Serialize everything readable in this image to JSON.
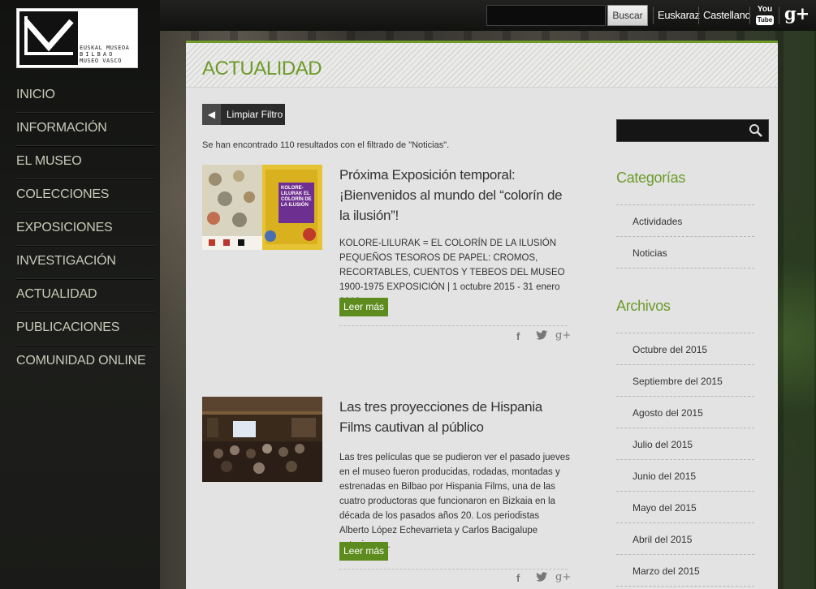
{
  "brand": {
    "logo_text_line1": "EUSKAL MUSEOA",
    "logo_text_line2": "BILBAO",
    "logo_text_line3": "MUSEO VASCO"
  },
  "topbar": {
    "search_button": "Buscar",
    "lang_eu": "Euskaraz",
    "lang_es": "Castellano",
    "youtube_label_top": "You",
    "youtube_label_bottom": "Tube",
    "gplus_label": "g+"
  },
  "nav": {
    "items": [
      {
        "label": "INICIO"
      },
      {
        "label": "INFORMACIÓN"
      },
      {
        "label": "EL MUSEO"
      },
      {
        "label": "COLECCIONES"
      },
      {
        "label": "EXPOSICIONES"
      },
      {
        "label": "INVESTIGACIÓN"
      },
      {
        "label": "ACTUALIDAD"
      },
      {
        "label": "PUBLICACIONES"
      },
      {
        "label": "COMUNIDAD ONLINE"
      }
    ]
  },
  "main": {
    "title": "ACTUALIDAD",
    "filter_button": "Limpiar Filtro",
    "results_text": "Se han encontrado 110 resultados con el filtrado de \"Noticias\".",
    "posts": [
      {
        "title": "Próxima Exposición temporal: ¡Bienvenidos al mundo del “colorín de la ilusión”!",
        "body": "KOLORE-LILURAK = EL COLORÍN DE LA ILUSIÓN PEQUEÑOS TESOROS DE PAPEL: CROMOS, RECORTABLES, CUENTOS Y TEBEOS DEL MUSEO 1900-1975 EXPOSICIÓN   |   1 octubre 2015 - 31 enero 2016",
        "thumb_caption": "KOLORE-LILURAK EL COLORÍN DE LA ILUSIÓN",
        "read_more": "Leer más"
      },
      {
        "title": "Las tres proyecciones de Hispania Films cautivan al público",
        "body": "Las tres películas  que se pudieron ver el pasado jueves en el museo fueron producidas, rodadas, montadas y estrenadas en Bilbao por Hispania Films, una de las cuatro productoras que funcionaron en Bizkaia en la década de los pasados años 20. Los periodistas Alberto López Echevarrieta y Carlos Bacigalupe estuvieron...",
        "read_more": "Leer más"
      }
    ]
  },
  "sidebar": {
    "categories_heading": "Categorías",
    "categories": [
      "Actividades",
      "Noticias"
    ],
    "archives_heading": "Archivos",
    "archives": [
      "Octubre del 2015",
      "Septiembre del 2015",
      "Agosto del 2015",
      "Julio del 2015",
      "Junio del 2015",
      "Mayo del 2015",
      "Abril del 2015",
      "Marzo del 2015"
    ]
  },
  "colors": {
    "accent_green": "#6d9a29",
    "button_green": "#5d8b1e",
    "sidebar_bg": "#1a1b18"
  },
  "icons": {
    "back": "chevron-left-icon",
    "search": "magnifier-icon",
    "share": [
      "facebook-icon",
      "twitter-icon",
      "google-plus-icon"
    ]
  }
}
